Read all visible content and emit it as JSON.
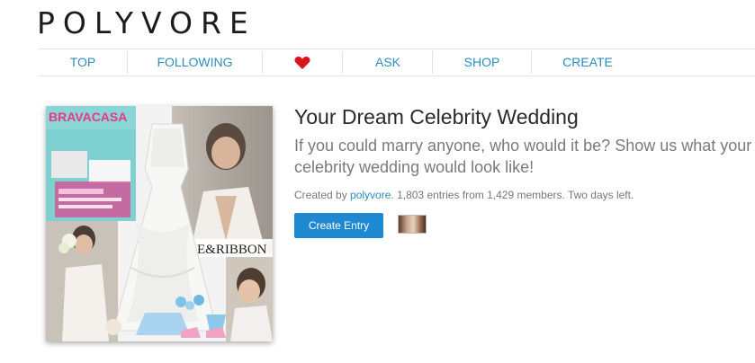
{
  "logo": "POLYVORE",
  "nav": {
    "top": "TOP",
    "following": "FOLLOWING",
    "favorites_icon": "heart-icon",
    "ask": "ASK",
    "shop": "SHOP",
    "create": "CREATE"
  },
  "contest": {
    "title": "Your Dream Celebrity Wedding",
    "description": "If you could marry anyone, who would it be? Show us what your celebrity wedding would look like!",
    "created_by_prefix": "Created by ",
    "creator": "polyvore",
    "stats": ". 1,803 entries from 1,429 members. Two days left.",
    "button_label": "Create Entry"
  },
  "collage_text": {
    "magazine_title": "BRAVACASA",
    "ribbon_text": "E&RIBBON"
  },
  "colors": {
    "link": "#2b8dbb",
    "button": "#1e88d3",
    "heart": "#d8151b"
  }
}
